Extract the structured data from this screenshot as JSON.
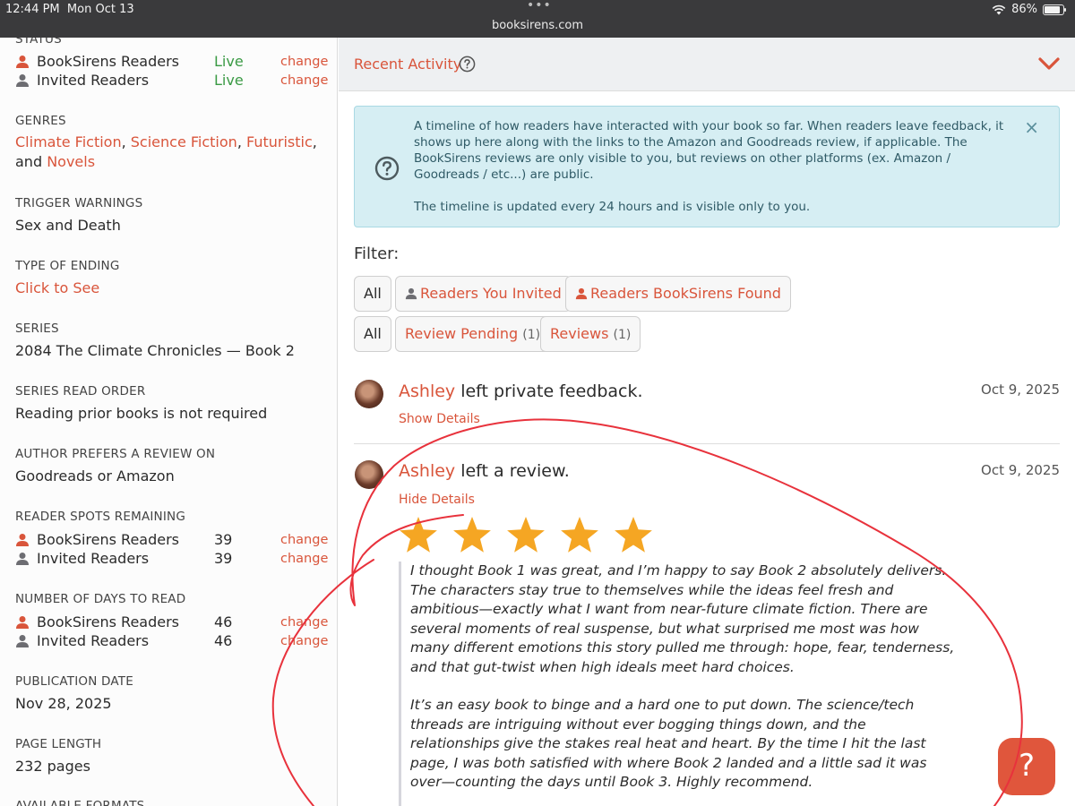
{
  "status_bar": {
    "time": "12:44 PM",
    "date": "Mon Oct 13",
    "url": "booksirens.com",
    "battery": "86%",
    "battery_level": 0.86,
    "menu_dots": "•••"
  },
  "sidebar": {
    "status": {
      "label": "STATUS",
      "rows": [
        {
          "icon": "person-orange-icon",
          "name": "BookSirens Readers",
          "value": "Live",
          "action": "change"
        },
        {
          "icon": "person-gray-icon",
          "name": "Invited Readers",
          "value": "Live",
          "action": "change"
        }
      ]
    },
    "genres": {
      "label": "GENRES",
      "items": [
        "Climate Fiction",
        "Science Fiction",
        "Futuristic",
        "Novels"
      ],
      "sep1": ", ",
      "sep2": ", ",
      "sep3": ", and "
    },
    "trigger_warnings": {
      "label": "TRIGGER WARNINGS",
      "value": "Sex and Death"
    },
    "type_of_ending": {
      "label": "TYPE OF ENDING",
      "value": "Click to See"
    },
    "series": {
      "label": "SERIES",
      "value": "2084 The Climate Chronicles — Book 2"
    },
    "series_read_order": {
      "label": "SERIES READ ORDER",
      "value": "Reading prior books is not required"
    },
    "author_prefers": {
      "label": "AUTHOR PREFERS A REVIEW ON",
      "value": "Goodreads or Amazon"
    },
    "reader_spots": {
      "label": "READER SPOTS REMAINING",
      "rows": [
        {
          "icon": "person-orange-icon",
          "name": "BookSirens Readers",
          "value": "39",
          "action": "change"
        },
        {
          "icon": "person-gray-icon",
          "name": "Invited Readers",
          "value": "39",
          "action": "change"
        }
      ]
    },
    "days_to_read": {
      "label": "NUMBER OF DAYS TO READ",
      "rows": [
        {
          "icon": "person-orange-icon",
          "name": "BookSirens Readers",
          "value": "46",
          "action": "change"
        },
        {
          "icon": "person-gray-icon",
          "name": "Invited Readers",
          "value": "46",
          "action": "change"
        }
      ]
    },
    "publication_date": {
      "label": "PUBLICATION DATE",
      "value": "Nov 28, 2025"
    },
    "page_length": {
      "label": "PAGE LENGTH",
      "value": "232 pages"
    },
    "available_formats": {
      "label": "AVAILABLE FORMATS"
    }
  },
  "activity": {
    "title": "Recent Activity",
    "info": {
      "p1": "A timeline of how readers have interacted with your book so far. When readers leave feedback, it shows up here along with the links to the Amazon and Goodreads review, if applicable. The BookSirens reviews are only visible to you, but reviews on other platforms (ex. Amazon / Goodreads / etc...) are public.",
      "p2": "The timeline is updated every 24 hours and is visible only to you.",
      "close": "×"
    },
    "filter": {
      "label": "Filter:",
      "row1": [
        {
          "label": "All"
        },
        {
          "label": "Readers You Invited"
        },
        {
          "label": "Readers BookSirens Found"
        }
      ],
      "row2": [
        {
          "label": "All"
        },
        {
          "label": "Review Pending",
          "count": "(1)"
        },
        {
          "label": "Reviews",
          "count": "(1)"
        }
      ]
    },
    "entries": [
      {
        "name": "Ashley",
        "action": " left private feedback.",
        "date": "Oct 9, 2025",
        "toggle": "Show Details"
      },
      {
        "name": "Ashley",
        "action": " left a review.",
        "date": "Oct 9, 2025",
        "toggle": "Hide Details",
        "rating": 5,
        "review_p1": "I thought Book 1 was great, and I’m happy to say Book 2 absolutely delivers. The characters stay true to themselves while the ideas feel fresh and ambitious—exactly what I want from near-future climate fiction. There are several moments of real suspense, but what surprised me most was how many different emotions this story pulled me through: hope, fear, tenderness, and that gut-twist when high ideals meet hard choices.",
        "review_p2": "It’s an easy book to binge and a hard one to put down. The science/tech threads are intriguing without ever bogging things down, and the relationships give the stakes real heat and heart. By the time I hit the last page, I was both satisfied with where Book 2 landed and a little sad it was over—counting the days until Book 3. Highly recommend."
      }
    ]
  },
  "help_button": {
    "label": "?"
  },
  "colors": {
    "accent": "#d9553b",
    "live": "#3a9a44",
    "star": "#f5a623",
    "info_bg": "#d6eef3",
    "annotation": "#e8323c"
  }
}
